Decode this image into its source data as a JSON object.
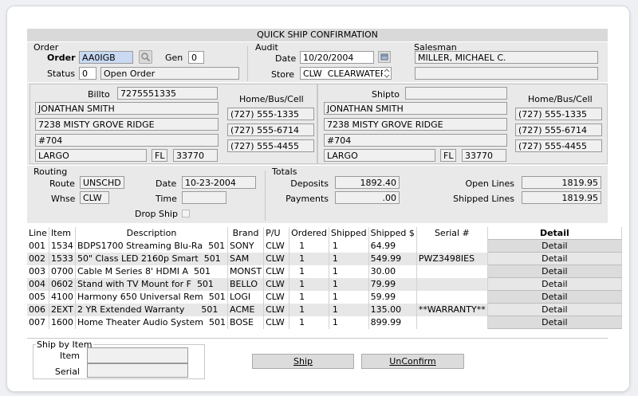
{
  "title": "QUICK SHIP CONFIRMATION",
  "order": {
    "section": "Order",
    "order_label": "Order",
    "order_value": "AA0IGB",
    "gen_label": "Gen",
    "gen_value": "0",
    "status_label": "Status",
    "status_code": "0",
    "status_text": "Open Order"
  },
  "audit": {
    "section": "Audit",
    "date_label": "Date",
    "date_value": "10/20/2004",
    "store_label": "Store",
    "store_code": "CLW",
    "store_name": "CLEARWATER S"
  },
  "salesman": {
    "section": "Salesman",
    "name": "MILLER, MICHAEL C.",
    "line2": ""
  },
  "billto": {
    "label": "Billto",
    "phone": "7275551335",
    "name": "JONATHAN SMITH",
    "address1": "7238 MISTY GROVE RIDGE",
    "address2": "#704",
    "city": "LARGO",
    "state": "FL",
    "zip": "33770",
    "phones_label": "Home/Bus/Cell",
    "home": "(727) 555-1335",
    "bus": "(727) 555-6714",
    "cell": "(727) 555-4455"
  },
  "shipto": {
    "label": "Shipto",
    "phone": "",
    "name": "JONATHAN SMITH",
    "address1": "7238 MISTY GROVE RIDGE",
    "address2": "#704",
    "city": "LARGO",
    "state": "FL",
    "zip": "33770",
    "phones_label": "Home/Bus/Cell",
    "home": "(727) 555-1335",
    "bus": "(727) 555-6714",
    "cell": "(727) 555-4455"
  },
  "routing": {
    "section": "Routing",
    "route_label": "Route",
    "route_value": "UNSCHD",
    "date_label": "Date",
    "date_value": "10-23-2004",
    "whse_label": "Whse",
    "whse_value": "CLW",
    "time_label": "Time",
    "time_value": "",
    "drop_ship_label": "Drop Ship"
  },
  "totals": {
    "section": "Totals",
    "deposits_label": "Deposits",
    "deposits_value": "1892.40",
    "payments_label": "Payments",
    "payments_value": ".00",
    "open_lines_label": "Open Lines",
    "open_lines_value": "1819.95",
    "shipped_lines_label": "Shipped Lines",
    "shipped_lines_value": "1819.95"
  },
  "table": {
    "headers": {
      "line": "Line",
      "item": "Item",
      "description": "Description",
      "brand": "Brand",
      "pu": "P/U",
      "ordered": "Ordered",
      "shipped": "Shipped",
      "shipped_amt": "Shipped $",
      "serial": "Serial #",
      "detail": "Detail"
    },
    "rows": [
      {
        "line": "001",
        "item": "1534",
        "description": "BDPS1700 Streaming Blu-Ra",
        "store": "501",
        "brand": "SONY",
        "pu": "CLW",
        "ordered": "1",
        "shipped": "1",
        "amount": "64.99",
        "serial": "",
        "detail": "Detail"
      },
      {
        "line": "002",
        "item": "1533",
        "description": "50\" Class LED 2160p Smart",
        "store": "501",
        "brand": "SAM",
        "pu": "CLW",
        "ordered": "1",
        "shipped": "1",
        "amount": "549.99",
        "serial": "PWZ3498IES",
        "detail": "Detail"
      },
      {
        "line": "003",
        "item": "0700",
        "description": "Cable M Series 8' HDMI A",
        "store": "501",
        "brand": "MONST",
        "pu": "CLW",
        "ordered": "1",
        "shipped": "1",
        "amount": "30.00",
        "serial": "",
        "detail": "Detail"
      },
      {
        "line": "004",
        "item": "0602",
        "description": "Stand with TV Mount for F",
        "store": "501",
        "brand": "BELLO",
        "pu": "CLW",
        "ordered": "1",
        "shipped": "1",
        "amount": "79.99",
        "serial": "",
        "detail": "Detail"
      },
      {
        "line": "005",
        "item": "4100",
        "description": "Harmony 650 Universal Rem",
        "store": "501",
        "brand": "LOGI",
        "pu": "CLW",
        "ordered": "1",
        "shipped": "1",
        "amount": "59.99",
        "serial": "",
        "detail": "Detail"
      },
      {
        "line": "006",
        "item": "2EXT",
        "description": "2 YR Extended Warranty",
        "store": "501",
        "brand": "ACME",
        "pu": "CLW",
        "ordered": "1",
        "shipped": "1",
        "amount": "135.00",
        "serial": "**WARRANTY**",
        "detail": "Detail"
      },
      {
        "line": "007",
        "item": "1600",
        "description": "Home Theater Audio System",
        "store": "501",
        "brand": "BOSE",
        "pu": "CLW",
        "ordered": "1",
        "shipped": "1",
        "amount": "899.99",
        "serial": "",
        "detail": "Detail"
      }
    ]
  },
  "ship_by_item": {
    "section": "Ship by Item",
    "item_label": "Item",
    "item_value": "",
    "serial_label": "Serial",
    "serial_value": ""
  },
  "buttons": {
    "ship": "Ship",
    "unconfirm": "UnConfirm"
  },
  "icons": {
    "lookup": "search-icon",
    "calendar": "calendar-icon",
    "dropdown": "chevron-down-icon",
    "checkbox": "checkbox-icon"
  }
}
